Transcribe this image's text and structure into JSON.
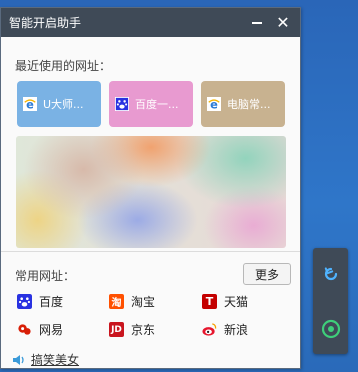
{
  "window": {
    "title": "智能开启助手",
    "minimize_icon": "minimize-icon",
    "close_icon": "close-icon",
    "close_glyph": "✕"
  },
  "recent": {
    "title": "最近使用的网址：",
    "tiles": [
      {
        "label": "U大师...",
        "icon": "ie-icon",
        "color": "#7ab2e4"
      },
      {
        "label": "百度一...",
        "icon": "baidu-paw-icon",
        "color": "#e89ad0"
      },
      {
        "label": "电脑常...",
        "icon": "ie-icon",
        "color": "#c8b290"
      }
    ]
  },
  "common": {
    "title": "常用网址：",
    "more_label": "更多",
    "sites": [
      {
        "label": "百度",
        "icon": "baidu-paw-icon",
        "color": "#2932e1"
      },
      {
        "label": "淘宝",
        "icon": "taobao-icon",
        "color": "#ff5000",
        "glyph": "淘"
      },
      {
        "label": "天猫",
        "icon": "tmall-icon",
        "color": "#c40000",
        "glyph": "T"
      },
      {
        "label": "网易",
        "icon": "netease-icon",
        "color": "#d81e06"
      },
      {
        "label": "京东",
        "icon": "jd-icon",
        "color": "#c9151e",
        "glyph": "JD"
      },
      {
        "label": "新浪",
        "icon": "sina-weibo-icon",
        "color": "#e6162d"
      }
    ]
  },
  "footer": {
    "icon": "speaker-icon",
    "link_label": "搞笑美女"
  },
  "side_panel": {
    "buttons": [
      {
        "icon": "refresh-icon",
        "color": "#4fb3ff"
      },
      {
        "icon": "power-icon",
        "color": "#3ecf7a"
      }
    ]
  }
}
